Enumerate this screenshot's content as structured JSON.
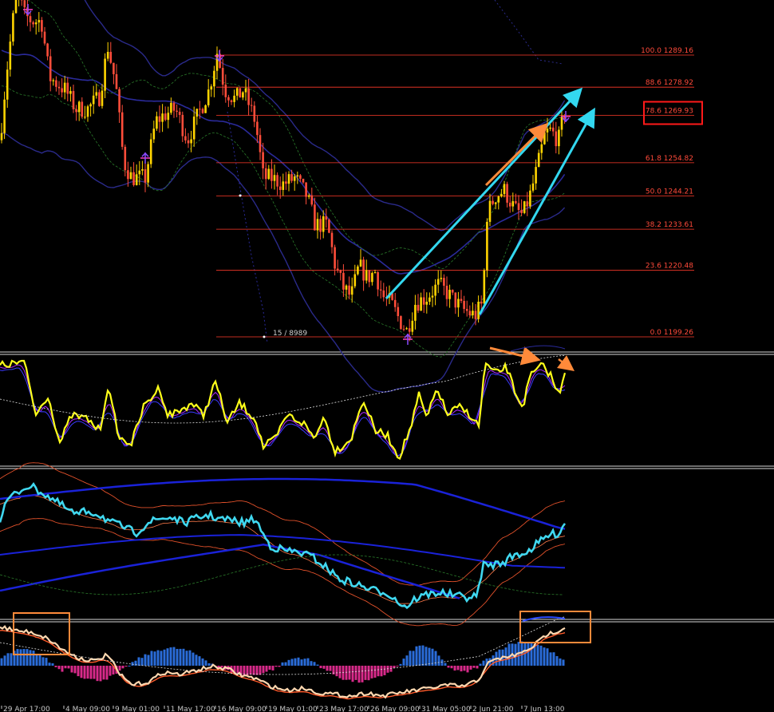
{
  "chart_data": {
    "type": "candlestick",
    "instrument_note": "",
    "price_range": [
      1190,
      1330
    ],
    "fibonacci_levels": [
      {
        "ratio": "100.0",
        "price": "1289.16"
      },
      {
        "ratio": "88.6",
        "price": "1278.92"
      },
      {
        "ratio": "78.6",
        "price": "1269.93",
        "highlighted": true
      },
      {
        "ratio": "61.8",
        "price": "1254.82"
      },
      {
        "ratio": "50.0",
        "price": "1244.21"
      },
      {
        "ratio": "38.2",
        "price": "1233.61"
      },
      {
        "ratio": "23.6",
        "price": "1220.48"
      },
      {
        "ratio": "0.0",
        "price": "1199.26"
      }
    ],
    "bar_counter": "15 / 8989",
    "time_labels": [
      "29 Apr 17:00",
      "4 May 09:00",
      "9 May 01:00",
      "11 May 17:00",
      "16 May 09:00",
      "19 May 01:00",
      "23 May 17:00",
      "26 May 09:00",
      "31 May 05:00",
      "2 Jun 21:00",
      "7 Jun 13:00"
    ],
    "panels": [
      "price",
      "oscillator",
      "bands",
      "histogram"
    ],
    "colors": {
      "background": "#000000",
      "bull_candle": "#ffd400",
      "bear_candle": "#ff4d3a",
      "fib_line": "#ff3a2a",
      "highlight_box": "#ff1a1a",
      "trend_arrow": "#33d8f0",
      "orange_arrow": "#ff8a3a",
      "oscillator": "#ffff1a",
      "band_main": "#40d8f0",
      "band_outer": "#1a22d8",
      "hist_up": "#2a6cd8",
      "hist_down": "#d82a8a",
      "hist_line": "#ffd8b0"
    }
  }
}
